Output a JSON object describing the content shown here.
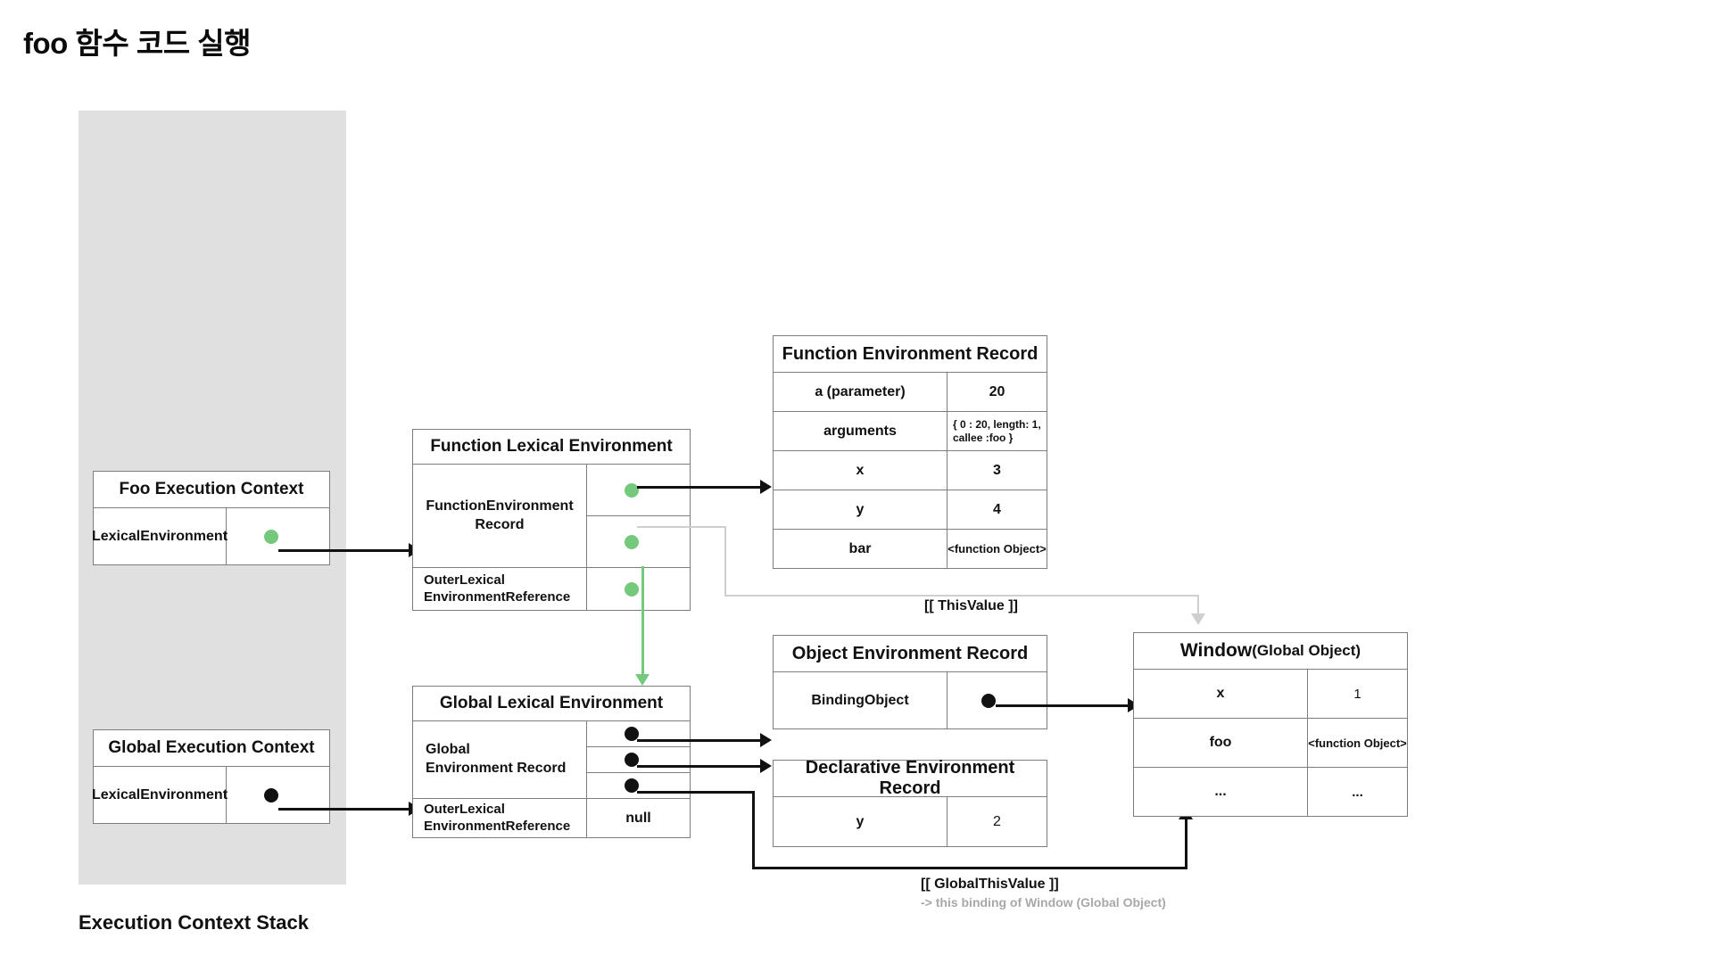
{
  "title": "foo 함수 코드 실행",
  "stack": {
    "label": "Execution Context Stack",
    "contexts": [
      {
        "title": "Foo Execution Context",
        "key": "LexicalEnvironment",
        "pointer_color": "#74c97c"
      },
      {
        "title": "Global Execution Context",
        "key": "LexicalEnvironment",
        "pointer_color": "#111111"
      }
    ]
  },
  "function_lexical_environment": {
    "title": "Function Lexical Environment",
    "record_label": "FunctionEnvironment\nRecord",
    "record_label_line1": "FunctionEnvironment",
    "record_label_line2": "Record",
    "outer_label_line1": "OuterLexical",
    "outer_label_line2": "EnvironmentReference",
    "outer_value": ""
  },
  "global_lexical_environment": {
    "title": "Global Lexical Environment",
    "record_label_line1": "Global",
    "record_label_line2": "Environment Record",
    "outer_label_line1": "OuterLexical",
    "outer_label_line2": "EnvironmentReference",
    "outer_value": "null"
  },
  "function_environment_record": {
    "title": "Function Environment Record",
    "rows": [
      {
        "name": "a (parameter)",
        "value": "20",
        "highlight": true
      },
      {
        "name": "arguments",
        "value": "{ 0 : 20, length: 1, callee :foo }",
        "highlight": false
      },
      {
        "name": "x",
        "value": "3",
        "highlight": true
      },
      {
        "name": "y",
        "value": "4",
        "highlight": true
      },
      {
        "name": "bar",
        "value": "<function Object>",
        "highlight": false
      }
    ]
  },
  "object_environment_record": {
    "title": "Object Environment Record",
    "rows": [
      {
        "name": "BindingObject",
        "value": ""
      }
    ]
  },
  "declarative_environment_record": {
    "title": "Declarative Environment Record",
    "rows": [
      {
        "name": "y",
        "value": "2",
        "highlight": false
      }
    ]
  },
  "window": {
    "title_main": "Window",
    "title_sub": "(Global Object)",
    "rows": [
      {
        "name": "x",
        "value": "1",
        "value_red": true
      },
      {
        "name": "foo",
        "value": "<function Object>",
        "value_red": false
      },
      {
        "name": "...",
        "value": "...",
        "value_red": false
      }
    ]
  },
  "annotations": {
    "this_value": "[[ ThisValue ]]",
    "global_this_value": "[[ GlobalThisValue ]]",
    "global_this_value_sub": "-> this binding of Window (Global Object)"
  },
  "colors": {
    "green": "#74c97c",
    "black": "#111111",
    "grey_line": "#cfcfcf",
    "stack_bg": "#e0e0e0",
    "pink_bg": "#fcdede",
    "red_text": "#f2696a",
    "border": "#7d7d7d"
  }
}
